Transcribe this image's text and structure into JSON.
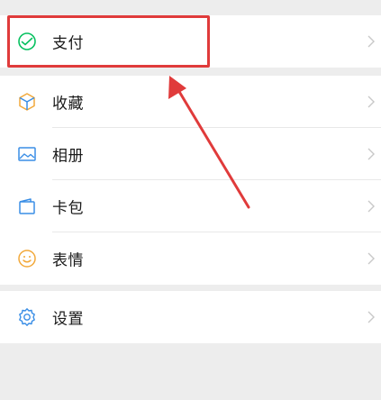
{
  "menu": {
    "group1": [
      {
        "label": "支付",
        "icon": "payment-icon"
      }
    ],
    "group2": [
      {
        "label": "收藏",
        "icon": "favorites-cube-icon"
      },
      {
        "label": "相册",
        "icon": "album-picture-icon"
      },
      {
        "label": "卡包",
        "icon": "card-wallet-icon"
      },
      {
        "label": "表情",
        "icon": "sticker-smile-icon"
      }
    ],
    "group3": [
      {
        "label": "设置",
        "icon": "settings-gear-icon"
      }
    ]
  },
  "colors": {
    "background": "#ededed",
    "row": "#ffffff",
    "payment_green": "#07c160",
    "blue_icon": "#3a8ee6",
    "orange_icon": "#f2a93b",
    "highlight_red": "#e03b3b"
  }
}
